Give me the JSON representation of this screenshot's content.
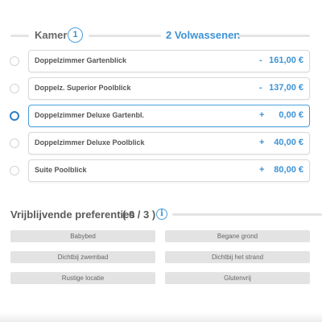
{
  "room": {
    "label": "Kamer",
    "number": "1",
    "adults": "2 Volwassenen"
  },
  "options": [
    {
      "name": "Doppelzimmer Gartenblick",
      "sign": "-",
      "price": "161,00 €",
      "selected": false
    },
    {
      "name": "Doppelz. Superior Poolblick",
      "sign": "-",
      "price": "137,00 €",
      "selected": false
    },
    {
      "name": "Doppelzimmer Deluxe Gartenbl.",
      "sign": "+",
      "price": "0,00 €",
      "selected": true
    },
    {
      "name": "Doppelzimmer Deluxe Poolblick",
      "sign": "+",
      "price": "40,00 €",
      "selected": false
    },
    {
      "name": "Suite Poolblick",
      "sign": "+",
      "price": "80,00 €",
      "selected": false
    }
  ],
  "preferences": {
    "title": "Vrijblijvende preferenties",
    "count": "( 0 / 3 )",
    "info_icon": "info-icon",
    "buttons": [
      "Babybed",
      "Begane grond",
      "Dichtbij zwembad",
      "Dichtbij het strand",
      "Rustige locatie",
      "Glutenvrij"
    ]
  },
  "colors": {
    "accent": "#3d93d6",
    "selected_border": "#4a9fdc",
    "button_bg": "#e3e3e3",
    "text": "#555555"
  }
}
